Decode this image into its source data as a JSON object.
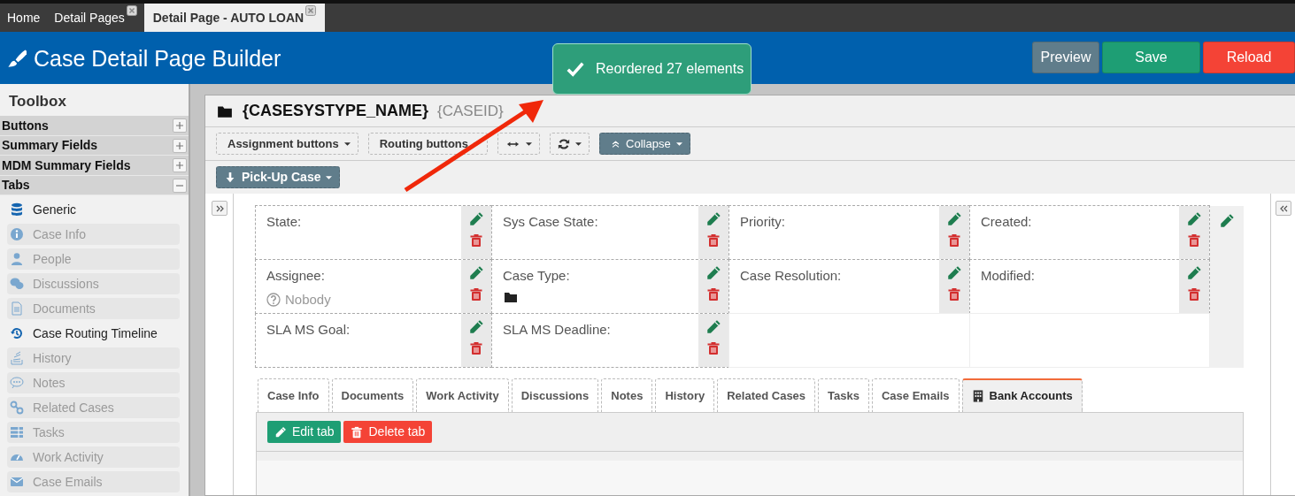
{
  "app_tabs": [
    {
      "label": "Home",
      "closable": false,
      "selected": false
    },
    {
      "label": "Detail Pages",
      "closable": true,
      "selected": false
    },
    {
      "label": "Detail Page - AUTO LOAN",
      "closable": true,
      "selected": true
    }
  ],
  "header": {
    "title": "Case Detail Page Builder",
    "buttons": [
      {
        "label": "Preview",
        "kind": "preview"
      },
      {
        "label": "Save",
        "kind": "save"
      },
      {
        "label": "Reload",
        "kind": "reload"
      }
    ]
  },
  "toast": {
    "message": "Reordered 27 elements"
  },
  "toolbox": {
    "title": "Toolbox",
    "sections": [
      {
        "label": "Buttons",
        "expanded": false
      },
      {
        "label": "Summary Fields",
        "expanded": false
      },
      {
        "label": "MDM Summary Fields",
        "expanded": false
      },
      {
        "label": "Tabs",
        "expanded": true,
        "items": [
          {
            "label": "Generic",
            "disabled": false
          },
          {
            "label": "Case Info",
            "disabled": true
          },
          {
            "label": "People",
            "disabled": true
          },
          {
            "label": "Discussions",
            "disabled": true
          },
          {
            "label": "Documents",
            "disabled": true
          },
          {
            "label": "Case Routing Timeline",
            "disabled": false
          },
          {
            "label": "History",
            "disabled": true
          },
          {
            "label": "Notes",
            "disabled": true
          },
          {
            "label": "Related Cases",
            "disabled": true
          },
          {
            "label": "Tasks",
            "disabled": true
          },
          {
            "label": "Work Activity",
            "disabled": true
          },
          {
            "label": "Case Emails",
            "disabled": true
          }
        ]
      }
    ]
  },
  "case_header": {
    "title": "{CASESYSTYPE_NAME}",
    "id": "{CASEID}"
  },
  "toolbar": [
    {
      "kind": "dropdown",
      "label": "Assignment buttons"
    },
    {
      "kind": "dropdown",
      "label": "Routing buttons"
    },
    {
      "kind": "width"
    },
    {
      "kind": "refresh"
    },
    {
      "kind": "collapse",
      "label": "Collapse"
    }
  ],
  "action_button": {
    "label": "Pick-Up Case"
  },
  "fields": [
    [
      {
        "kind": "field",
        "label": "State:"
      },
      {
        "kind": "field",
        "label": "Sys Case State:"
      },
      {
        "kind": "field",
        "label": "Priority:"
      },
      {
        "kind": "field",
        "label": "Created:"
      }
    ],
    [
      {
        "kind": "field",
        "label": "Assignee:",
        "value": {
          "kind": "unknown",
          "text": "Nobody"
        }
      },
      {
        "kind": "field",
        "label": "Case Type:",
        "value": {
          "kind": "folder"
        }
      },
      {
        "kind": "field",
        "label": "Case Resolution:"
      },
      {
        "kind": "field",
        "label": "Modified:"
      }
    ],
    [
      {
        "kind": "field",
        "label": "SLA MS Goal:"
      },
      {
        "kind": "field",
        "label": "SLA MS Deadline:"
      },
      {
        "kind": "empty"
      },
      {
        "kind": "empty"
      }
    ]
  ],
  "detail_tabs": [
    {
      "label": "Case Info",
      "kind": "standard",
      "selected": false
    },
    {
      "label": "Documents",
      "kind": "standard",
      "selected": false
    },
    {
      "label": "Work Activity",
      "kind": "standard",
      "selected": false
    },
    {
      "label": "Discussions",
      "kind": "standard",
      "selected": false
    },
    {
      "label": "Notes",
      "kind": "standard",
      "selected": false
    },
    {
      "label": "History",
      "kind": "standard",
      "selected": false
    },
    {
      "label": "Related Cases",
      "kind": "standard",
      "selected": false
    },
    {
      "label": "Tasks",
      "kind": "standard",
      "selected": false
    },
    {
      "label": "Case Emails",
      "kind": "standard",
      "selected": false
    },
    {
      "label": "Bank Accounts",
      "kind": "custom",
      "selected": true
    }
  ],
  "tab_actions": [
    {
      "label": "Edit tab",
      "kind": "edit"
    },
    {
      "label": "Delete tab",
      "kind": "delete"
    }
  ]
}
